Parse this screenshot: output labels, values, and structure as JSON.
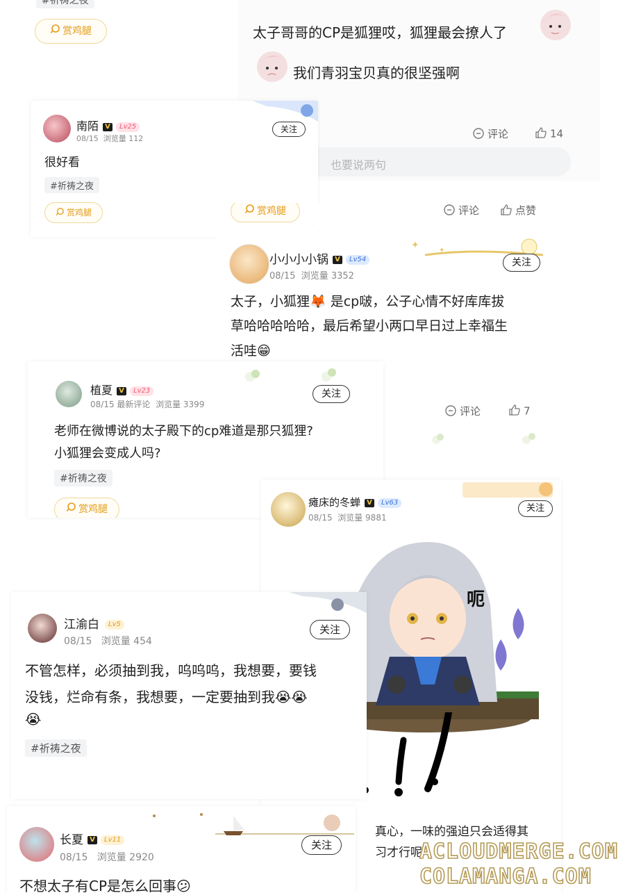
{
  "top_left": {
    "tag": "#祈祷之夜",
    "reward": "赏鸡腿"
  },
  "top_right": {
    "line1": "太子哥哥的CP是狐狸哎，狐狸最会撩人了",
    "line2": "我们青羽宝贝真的很坚强啊",
    "comment": "评论",
    "likes": "14",
    "reply_placeholder": "也要说两句"
  },
  "nanmo": {
    "name": "南陌",
    "level": "Lv25",
    "date": "08/15",
    "views": "浏览量 112",
    "follow": "关注",
    "text": "很好看",
    "tag": "#祈祷之夜",
    "reward": "赏鸡腿"
  },
  "mid_actions": {
    "reward": "赏鸡腿",
    "comment": "评论",
    "like": "点赞"
  },
  "xiaoguo": {
    "name": "小小小小锅",
    "level": "Lv54",
    "date": "08/15",
    "views": "浏览量 3352",
    "follow": "关注",
    "line1": "太子，小狐狸🦊  是cp啵，公子心情不好库库拔",
    "line2": "草哈哈哈哈哈，最后希望小两口早日过上幸福生",
    "line3": "活哇😁",
    "comment": "评论",
    "likes": "7"
  },
  "zhixia": {
    "name": "植夏",
    "level": "Lv23",
    "date": "08/15",
    "latest": "最新评论",
    "views": "浏览量 3399",
    "follow": "关注",
    "line1": "老师在微博说的太子殿下的cp难道是那只狐狸?",
    "line2": "小狐狸会变成人吗?",
    "tag": "#祈祷之夜",
    "reward": "赏鸡腿"
  },
  "dongchan": {
    "name": "瘫床的冬蝉",
    "level": "Lv63",
    "date": "08/15",
    "views": "浏览量 9881",
    "follow": "关注",
    "sticker_text": "呃",
    "bottom_line1": "真心，一味的强迫只会适得其",
    "bottom_line2": "习才行呢"
  },
  "jiangyubai": {
    "name": "江渝白",
    "level": "Lv5",
    "date": "08/15",
    "views": "浏览量 454",
    "follow": "关注",
    "line1": "不管怎样，必须抽到我，呜呜呜，我想要，要钱",
    "line2": "没钱，烂命有条，我想要，一定要抽到我😭😭",
    "line3": "😭",
    "tag": "#祈祷之夜"
  },
  "changxia": {
    "name": "长夏",
    "level": "Lv11",
    "date": "08/15",
    "views": "浏览量 2920",
    "follow": "关注",
    "text": "不想太子有CP是怎么回事😕"
  },
  "watermark": {
    "line1": "ACLOUDMERGE.COM",
    "line2": "COLAMANGA.COM"
  },
  "colors": {
    "accent_gold": "#e49b18",
    "level_pink": "#ee5b74",
    "level_blue": "#3d72d6"
  }
}
